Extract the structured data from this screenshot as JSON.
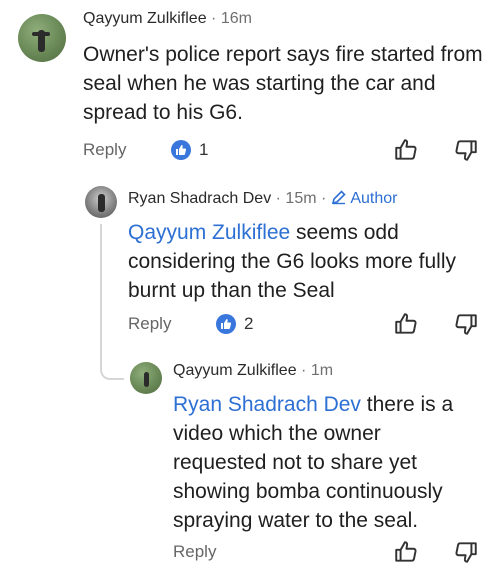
{
  "comments": [
    {
      "author": "Qayyum Zulkiflee",
      "time": "16m",
      "text": "Owner's police report says fire started from seal when he was starting the car and spread to his G6.",
      "reply_label": "Reply",
      "like_count": "1"
    },
    {
      "author": "Ryan Shadrach Dev",
      "time": "15m",
      "badge": "Author",
      "mention": "Qayyum Zulkiflee",
      "text": " seems odd considering the G6 looks more fully burnt up than the Seal",
      "reply_label": "Reply",
      "like_count": "2"
    },
    {
      "author": "Qayyum Zulkiflee",
      "time": "1m",
      "mention": "Ryan Shadrach Dev",
      "text": " there is a video which the owner requested not to share yet showing bomba continuously spraying water to the seal.",
      "reply_label": "Reply"
    }
  ],
  "separator": "·",
  "icons": [
    "thumbs-up-icon",
    "thumbs-down-icon",
    "pencil-icon",
    "like-badge-icon"
  ],
  "colors": {
    "link": "#2d6fd3",
    "badge": "#3a77dd"
  }
}
